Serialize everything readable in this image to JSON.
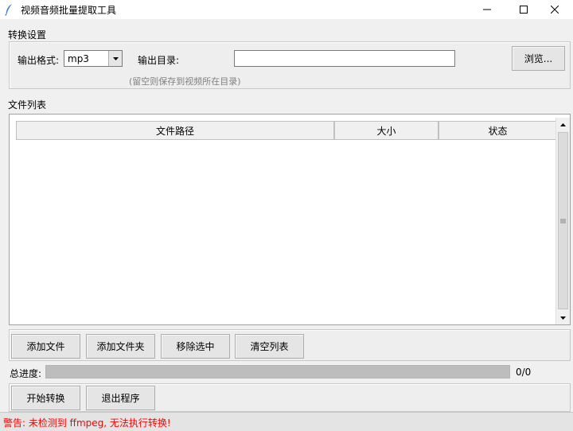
{
  "window": {
    "title": "视频音频批量提取工具",
    "icon": "feather-icon"
  },
  "settings": {
    "group_label": "转换设置",
    "format_label": "输出格式:",
    "format_value": "mp3",
    "dir_label": "输出目录:",
    "dir_value": "",
    "browse_label": "浏览...",
    "hint": "(留空则保存到视频所在目录)"
  },
  "file_list": {
    "group_label": "文件列表",
    "columns": [
      "文件路径",
      "大小",
      "状态"
    ],
    "rows": []
  },
  "actions": {
    "add_file": "添加文件",
    "add_folder": "添加文件夹",
    "remove_selected": "移除选中",
    "clear_list": "清空列表"
  },
  "progress": {
    "label": "总进度:",
    "value": 0,
    "text": "0/0"
  },
  "controls": {
    "start": "开始转换",
    "exit": "退出程序"
  },
  "status": {
    "warning": "警告: 未检测到 ffmpeg, 无法执行转换!",
    "warning_color": "#ff0000"
  }
}
